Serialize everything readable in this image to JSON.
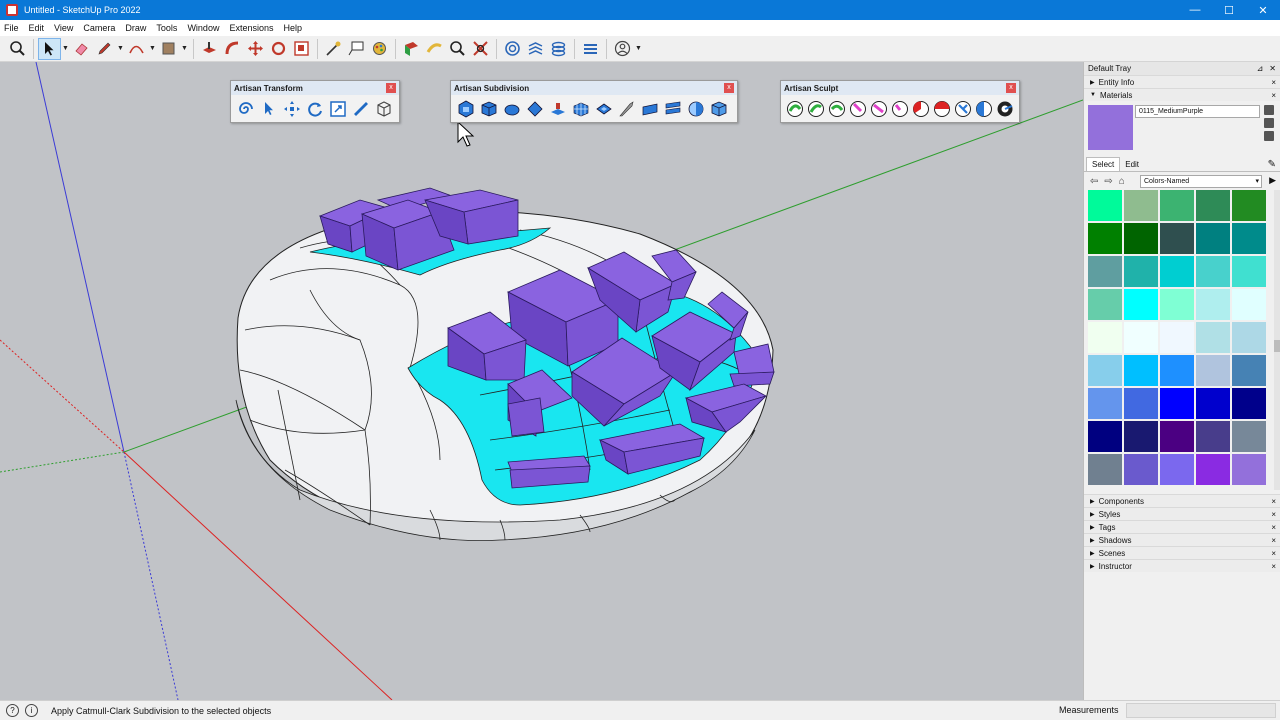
{
  "window": {
    "title": "Untitled - SketchUp Pro 2022",
    "controls": [
      "—",
      "☐",
      "✕"
    ]
  },
  "menu": [
    "File",
    "Edit",
    "View",
    "Camera",
    "Draw",
    "Tools",
    "Window",
    "Extensions",
    "Help"
  ],
  "toolbar": {
    "icons": [
      "search-icon",
      "select-icon",
      "eraser-icon",
      "pencil-icon",
      "arc-icon",
      "paint-bucket-icon",
      "push-pull-icon",
      "follow-me-icon",
      "move-icon",
      "rotate-icon",
      "scale-icon",
      "tape-measure-icon",
      "text-icon",
      "paint-icon",
      "section-plane-icon",
      "orbit-icon",
      "zoom-icon",
      "zoom-extents-icon",
      "warehouse-icon",
      "extension-warehouse-icon",
      "layout-icon",
      "style-builder-icon",
      "account-icon"
    ]
  },
  "floating_toolbars": [
    {
      "title": "Artisan Transform",
      "buttons": 6
    },
    {
      "title": "Artisan Subdivision",
      "buttons": 12
    },
    {
      "title": "Artisan Sculpt",
      "buttons": 10
    }
  ],
  "tray": {
    "title": "Default Tray",
    "panels_top": [
      "Entity Info",
      "Materials"
    ],
    "material_name": "0115_MediumPurple",
    "material_color": "#9370db",
    "tabs": [
      "Select",
      "Edit"
    ],
    "collection": "Colors-Named",
    "swatches": [
      "#00fa9a",
      "#8fbc8f",
      "#3cb371",
      "#2e8b57",
      "#228b22",
      "#008000",
      "#006400",
      "#2f4f4f",
      "#008080",
      "#008b8b",
      "#5f9ea0",
      "#20b2aa",
      "#00ced1",
      "#48d1cc",
      "#40e0d0",
      "#66cdaa",
      "#00ffff",
      "#7fffd4",
      "#afeeee",
      "#e0ffff",
      "#f0fff0",
      "#f0ffff",
      "#f0f8ff",
      "#b0e0e6",
      "#add8e6",
      "#87ceeb",
      "#00bfff",
      "#1e90ff",
      "#b0c4de",
      "#4682b4",
      "#6495ed",
      "#4169e1",
      "#0000ff",
      "#0000cd",
      "#00008b",
      "#000080",
      "#191970",
      "#4b0082",
      "#483d8b",
      "#778899",
      "#708090",
      "#6a5acd",
      "#7b68ee",
      "#8a2be2",
      "#9370db"
    ],
    "panels_bottom": [
      "Components",
      "Styles",
      "Tags",
      "Shadows",
      "Scenes",
      "Instructor"
    ]
  },
  "status": {
    "message": "Apply Catmull-Clark Subdivision to the selected objects",
    "measurements_label": "Measurements",
    "measurements_value": ""
  },
  "colors": {
    "titlebar": "#0a78d7",
    "viewport_bg": "#c1c3c7",
    "cube_face_top": "#8a63e0",
    "cube_face_side": "#6a45c4",
    "cyan_inset": "#19e6f0"
  }
}
